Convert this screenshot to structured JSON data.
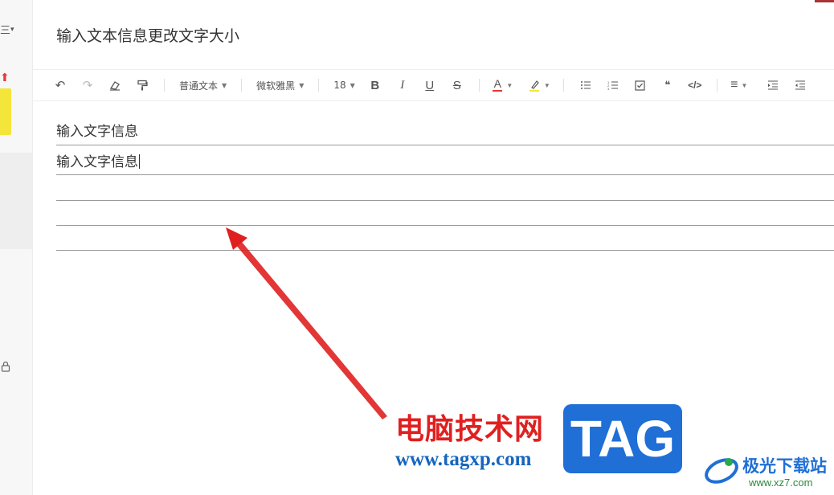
{
  "sidebar": {
    "menu_glyph": "三",
    "menu_caret": "▾",
    "arrow_glyph": "⬆"
  },
  "document": {
    "title": "输入文本信息更改文字大小"
  },
  "toolbar": {
    "undo_icon": "↶",
    "redo_icon": "↷",
    "eraser_icon": "eraser-icon",
    "format_painter_icon": "paint-roller-icon",
    "paragraph_style": "普通文本",
    "font_family": "微软雅黑",
    "font_size": "18",
    "bold": "B",
    "italic": "I",
    "underline": "U",
    "strike": "S",
    "font_color_letter": "A",
    "font_color": "#e53935",
    "highlight_color": "#f4e53a",
    "bullet_list_icon": "☰",
    "quote_icon": "❝",
    "code_icon": "</>",
    "align_icon": "≡"
  },
  "editor": {
    "lines": [
      "输入文字信息",
      "输入文字信息",
      "",
      "",
      ""
    ]
  },
  "watermark": {
    "site_name": "电脑技术网",
    "site_url": "www.tagxp.com",
    "tag": "TAG",
    "brand_name": "极光下载站",
    "brand_url": "www.xz7.com"
  }
}
